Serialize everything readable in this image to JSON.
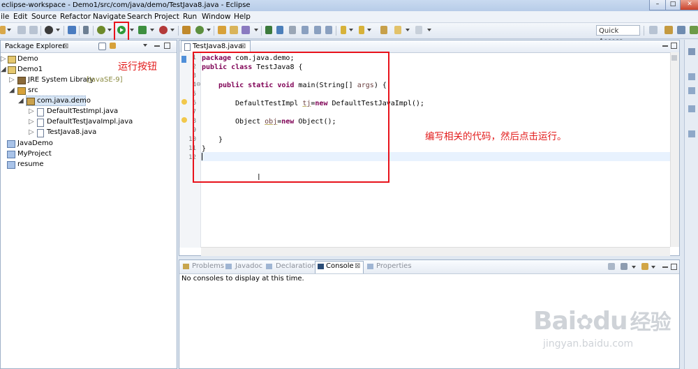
{
  "window": {
    "title": "eclipse-workspace - Demo1/src/com/java/demo/TestJava8.java - Eclipse",
    "minimize": "–",
    "maximize": "□",
    "close": "✕"
  },
  "menubar": [
    "ile",
    "Edit",
    "Source",
    "Refactor",
    "Navigate",
    "Search",
    "Project",
    "Run",
    "Window",
    "Help"
  ],
  "toolbar": {
    "quick_access": "Quick Access"
  },
  "package_explorer": {
    "tab_label": "Package Explorer",
    "close_glyph": "⊠",
    "tree": [
      {
        "label": "Demo"
      },
      {
        "label": "Demo1"
      },
      {
        "label": "JRE System Library",
        "suffix": "[JavaSE-9]"
      },
      {
        "label": "src"
      },
      {
        "label": "com.java.demo"
      },
      {
        "label": "DefaultTestImpl.java"
      },
      {
        "label": "DefaultTestJavaImpl.java"
      },
      {
        "label": "TestJava8.java"
      },
      {
        "label": "JavaDemo"
      },
      {
        "label": "MyProject"
      },
      {
        "label": "resume"
      }
    ]
  },
  "editor": {
    "tab_label": "TestJava8.java",
    "close_glyph": "⊠",
    "line_numbers": [
      "1",
      "2",
      "3",
      "4",
      "5",
      "6",
      "7",
      "8",
      "9",
      "10",
      "11",
      "12"
    ],
    "code": {
      "l1_kw": "package",
      "l1_rest": " com.java.demo;",
      "l2_kw1": "public",
      "l2_kw2": "class",
      "l2_rest": " TestJava8 {",
      "l4_kw1": "public",
      "l4_kw2": "static",
      "l4_kw3": "void",
      "l4_rest": " main(String[] ",
      "l4_var": "args",
      "l4_end": ") {",
      "l6_a": "DefaultTestImpl ",
      "l6_var": "tj",
      "l6_b": "=",
      "l6_kw": "new",
      "l6_c": " DefaultTestJavaImpl();",
      "l8_a": "Object ",
      "l8_var": "obj",
      "l8_b": "=",
      "l8_kw": "new",
      "l8_c": " Object();",
      "l10": "}",
      "l11": "}"
    }
  },
  "annotations": {
    "run_button": "运行按钮",
    "instruction": "编写相关的代码，然后点击运行。"
  },
  "console_panel": {
    "tabs": [
      "Problems",
      "Javadoc",
      "Declaration",
      "Console",
      "Properties"
    ],
    "active_tab": "Console",
    "message": "No consoles to display at this time."
  },
  "watermark": {
    "brand": "Bai",
    "brand2": "du",
    "cn": "经验",
    "url": "jingyan.baidu.com"
  },
  "colors": {
    "keyword": "#7f0055",
    "annotation_red": "#e21a1a",
    "run_green": "#2f9a3a"
  }
}
